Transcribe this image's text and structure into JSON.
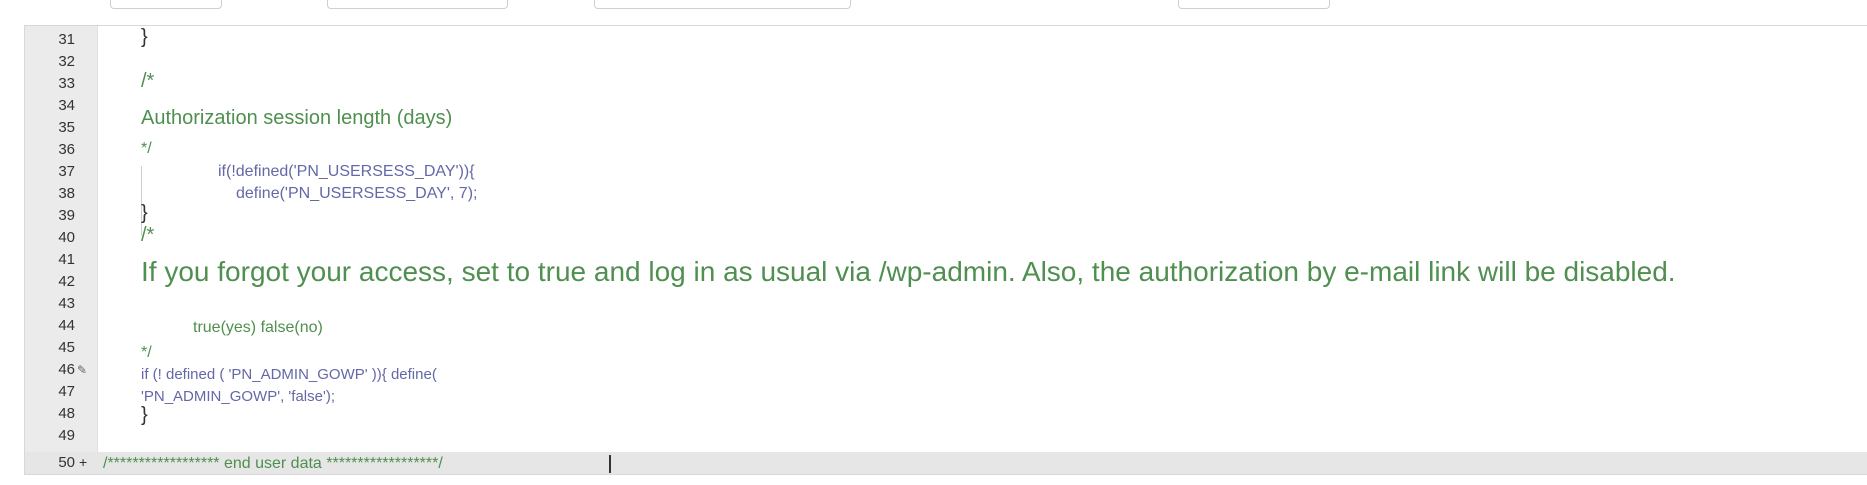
{
  "top_tabs": [
    {},
    {},
    {},
    {}
  ],
  "editor": {
    "line_numbers": [
      "31",
      "32",
      "33",
      "34",
      "35",
      "36",
      "37",
      "38",
      "39",
      "40",
      "41",
      "42",
      "43",
      "44",
      "45",
      "46",
      "47",
      "48",
      "49",
      "50"
    ],
    "fold_marker": "+",
    "code": {
      "l31": "}",
      "l33": "/*",
      "l35": "Authorization session length (days)",
      "l36": "*/",
      "l37": "if(!defined('PN_USERSESS_DAY')){",
      "l38": "define('PN_USERSESS_DAY', 7);",
      "l39": "}",
      "l40": "/*",
      "l42": "If you forgot your access, set to true and log in as usual via /wp-admin. Also, the authorization by e-mail link will be disabled.",
      "l44": "true(yes) false(no)",
      "l45": "*/",
      "l46": "if (! defined ( 'PN_ADMIN_GOWP' )){ define(",
      "l47": "'PN_ADMIN_GOWP', 'false');",
      "l48": "}",
      "l50": "/****************** end user data ******************/"
    }
  }
}
